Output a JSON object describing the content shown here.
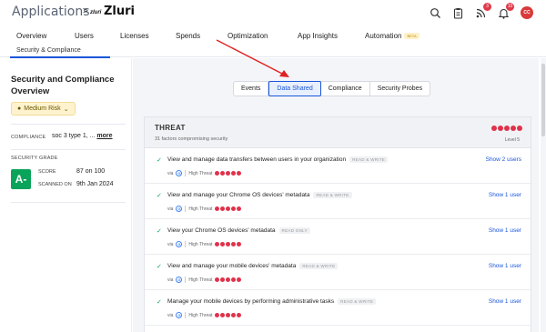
{
  "header": {
    "app_title": "Applications",
    "crumb_sep": ">",
    "app_logo_text": "zluri",
    "app_name": "Zluri",
    "notif_badge": "3",
    "bell_badge": "10",
    "avatar_initials": "CC"
  },
  "tabs": [
    {
      "label": "Overview"
    },
    {
      "label": "Users"
    },
    {
      "label": "Licenses"
    },
    {
      "label": "Spends"
    },
    {
      "label": "Optimization"
    },
    {
      "label": "App Insights"
    },
    {
      "label": "Automation",
      "badge": "BETA"
    }
  ],
  "subtab": "Security & Compliance",
  "sidebar": {
    "title": "Security and Compliance Overview",
    "risk_label": "Medium Risk",
    "compliance_label": "COMPLIANCE",
    "compliance_value": "soc 3 type 1, ...",
    "compliance_more": "more",
    "security_grade_label": "SECURITY GRADE",
    "grade": "A-",
    "score_label": "SCORE",
    "score_value": "87 on 100",
    "scanned_label": "SCANNED ON",
    "scanned_value": "9th Jan 2024"
  },
  "segments": [
    "Events",
    "Data Shared",
    "Compliance",
    "Security Probes"
  ],
  "active_segment": "Data Shared",
  "threat": {
    "title": "THREAT",
    "subtitle": "31 factors compromising security",
    "level": "Level 5",
    "dots": 5
  },
  "permissions": [
    {
      "text": "View and manage data transfers between users in your organization",
      "access": "READ & WRITE",
      "threat": "High Threat",
      "link": "Show 2 users"
    },
    {
      "text": "View and manage your Chrome OS devices' metadata",
      "access": "READ & WRITE",
      "threat": "High Threat",
      "link": "Show 1 user"
    },
    {
      "text": "View your Chrome OS devices' metadata",
      "access": "READ ONLY",
      "threat": "High Threat",
      "link": "Show 1 user"
    },
    {
      "text": "View and manage your mobile devices' metadata",
      "access": "READ & WRITE",
      "threat": "High Threat",
      "link": "Show 1 user"
    },
    {
      "text": "Manage your mobile devices by performing administrative tasks",
      "access": "READ & WRITE",
      "threat": "High Threat",
      "link": "Show 1 user"
    }
  ],
  "source_label": "via",
  "colors": {
    "accent": "#1a56db",
    "threat": "#e0324b",
    "grade": "#0aa35a",
    "arrow": "#e02020"
  }
}
